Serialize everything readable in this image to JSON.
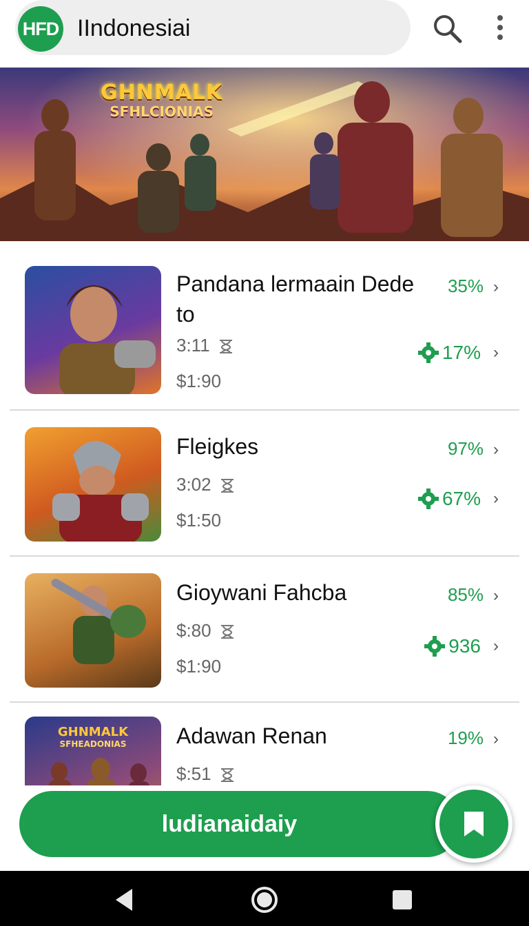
{
  "header": {
    "logo_text": "HFD",
    "title": "IIndonesiai"
  },
  "banner": {
    "title_line1": "GHNMALK",
    "title_line2": "SFHLCIONIAS"
  },
  "games": [
    {
      "title": "Pandana lermaain Dede to",
      "time": "3:11",
      "price": "$1:90",
      "pct_top": "35%",
      "pct_bottom": "17%"
    },
    {
      "title": "Fleigkes",
      "time": "3:02",
      "price": "$1:50",
      "pct_top": "97%",
      "pct_bottom": "67%"
    },
    {
      "title": "Gioywani Fahcba",
      "time": "$:80",
      "price": "$1:90",
      "pct_top": "85%",
      "pct_bottom": "936"
    },
    {
      "title": "Adawan Renan",
      "time": "$:51",
      "price": "",
      "pct_top": "19%",
      "pct_bottom": ""
    }
  ],
  "actionbar": {
    "label": "ludianaidaiy"
  },
  "colors": {
    "accent": "#1e9e4f"
  }
}
